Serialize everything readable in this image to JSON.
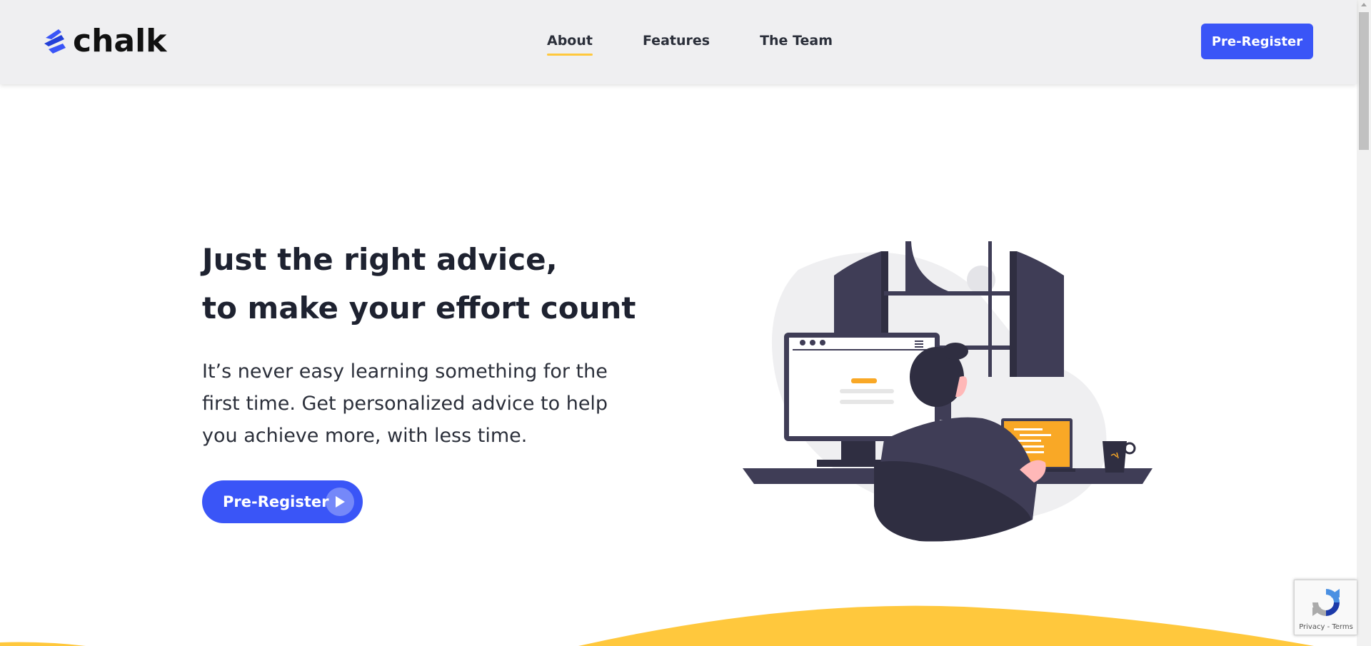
{
  "header": {
    "logo_text": "chalk",
    "nav": [
      {
        "label": "About",
        "active": true
      },
      {
        "label": "Features",
        "active": false
      },
      {
        "label": "The Team",
        "active": false
      }
    ],
    "cta_label": "Pre-Register"
  },
  "hero": {
    "title_line1": "Just the right advice,",
    "title_line2": "to make your effort count",
    "description": "It’s never easy learning something for the first time. Get personalized advice to help you achieve more, with less time.",
    "cta_label": "Pre-Register"
  },
  "recaptcha": {
    "links": "Privacy - Terms"
  },
  "icons": {
    "logo": "chalk-logo-icon",
    "play": "play-icon",
    "recaptcha": "recaptcha-icon"
  },
  "colors": {
    "accent_blue": "#3a55f7",
    "accent_yellow": "#ffc83d",
    "header_bg": "#efeff1",
    "text_dark": "#1e2230"
  }
}
